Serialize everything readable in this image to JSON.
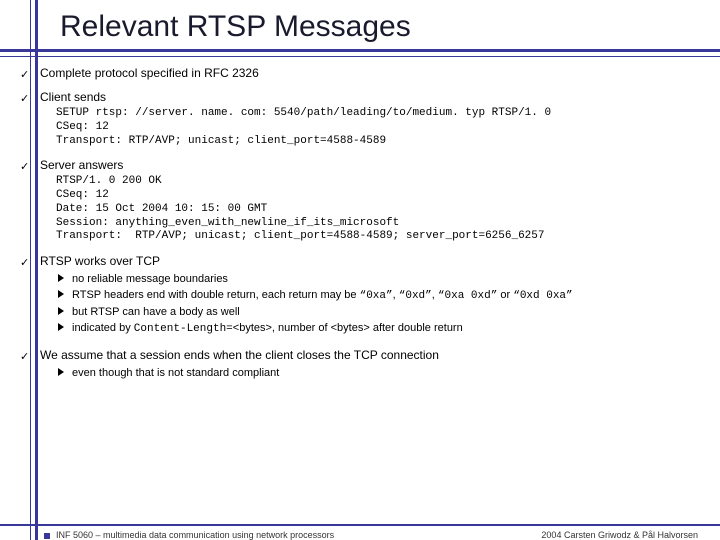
{
  "title": "Relevant RTSP Messages",
  "bullets": {
    "b1": "Complete protocol specified in RFC 2326",
    "b2": "Client sends",
    "b2_code": "SETUP rtsp: //server. name. com: 5540/path/leading/to/medium. typ RTSP/1. 0\nCSeq: 12\nTransport: RTP/AVP; unicast; client_port=4588-4589",
    "b3": "Server answers",
    "b3_code": "RTSP/1. 0 200 OK\nCSeq: 12\nDate: 15 Oct 2004 10: 15: 00 GMT\nSession: anything_even_with_newline_if_its_microsoft\nTransport:  RTP/AVP; unicast; client_port=4588-4589; server_port=6256_6257",
    "b4": "RTSP works over TCP",
    "b4_sub": {
      "s1": "no reliable message boundaries",
      "s2_pre": "RTSP headers end with double return, each return may be ",
      "s2_q1": "“0xa”",
      "s2_c1": ", ",
      "s2_q2": "“0xd”",
      "s2_c2": ", ",
      "s2_q3": "“0xa 0xd”",
      "s2_or": " or ",
      "s2_q4": "“0xd 0xa”",
      "s3": "but RTSP can have a body as well",
      "s4_pre": "indicated by ",
      "s4_code": "Content-Length=",
      "s4_post": "<bytes>, number of <bytes> after double return"
    },
    "b5": "We assume that a session ends when the client closes the TCP connection",
    "b5_sub": {
      "s1": "even though that is not standard compliant"
    }
  },
  "footer": {
    "left": "INF 5060 – multimedia data communication using network processors",
    "right": "2004  Carsten Griwodz & Pål Halvorsen"
  }
}
